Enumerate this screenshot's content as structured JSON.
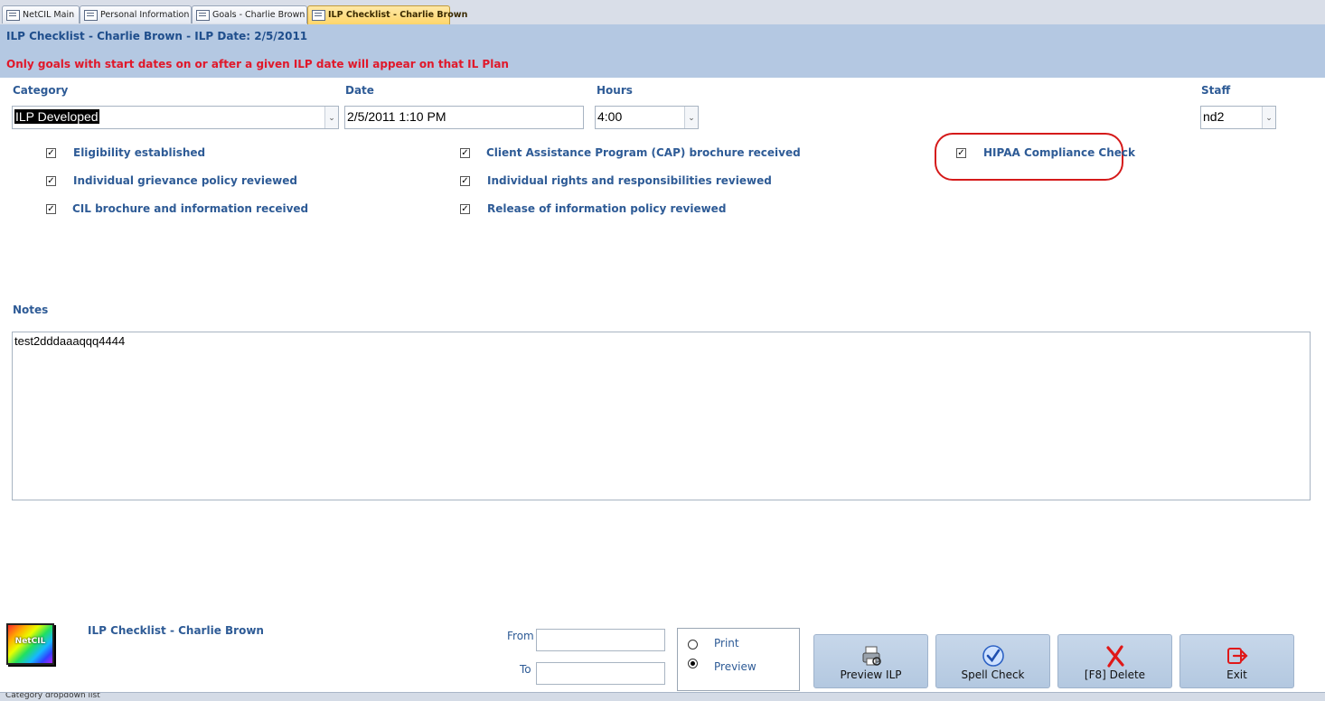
{
  "tabs": [
    {
      "label": "NetCIL Main",
      "active": false
    },
    {
      "label": "Personal Information",
      "active": false
    },
    {
      "label": "Goals - Charlie Brown",
      "active": false
    },
    {
      "label": "ILP Checklist - Charlie Brown",
      "active": true
    }
  ],
  "header": {
    "title": "ILP Checklist - Charlie Brown - ILP Date: 2/5/2011",
    "notice": "Only goals with start dates on or after a given ILP date will appear on that IL Plan",
    "notice_color": "#e0182a"
  },
  "form": {
    "category": {
      "label": "Category",
      "value": "ILP Developed"
    },
    "date": {
      "label": "Date",
      "value": "2/5/2011 1:10 PM"
    },
    "hours": {
      "label": "Hours",
      "value": "4:00"
    },
    "staff": {
      "label": "Staff",
      "value": "nd2"
    }
  },
  "checklist": [
    {
      "label": "Eligibility established",
      "checked": true
    },
    {
      "label": "Individual grievance policy reviewed",
      "checked": true
    },
    {
      "label": "CIL brochure and information received",
      "checked": true
    },
    {
      "label": "Client Assistance Program (CAP) brochure received",
      "checked": true
    },
    {
      "label": "Individual rights and responsibilities reviewed",
      "checked": true
    },
    {
      "label": "Release of information policy reviewed",
      "checked": true
    },
    {
      "label": "HIPAA Compliance Check",
      "checked": true
    }
  ],
  "notes": {
    "label": "Notes",
    "value": "test2dddaaaqqq4444"
  },
  "footer": {
    "logo_text": "NetCIL",
    "title": "ILP Checklist - Charlie Brown",
    "from_label": "From",
    "to_label": "To",
    "output_options": [
      {
        "label": "Print",
        "selected": false
      },
      {
        "label": "Preview",
        "selected": true
      }
    ],
    "buttons": [
      {
        "label": "Preview ILP",
        "icon": "preview-icon"
      },
      {
        "label": "Spell Check",
        "icon": "spell-check-icon"
      },
      {
        "label": "[F8] Delete",
        "icon": "delete-x-icon"
      },
      {
        "label": "Exit",
        "icon": "exit-icon"
      }
    ]
  },
  "status_bar": {
    "text": "Category dropdown list"
  },
  "colors": {
    "label_blue": "#2e5b96",
    "header_band": "#b4c8e2",
    "highlight_red": "#d51a1a",
    "active_tab": "#ffd66b"
  }
}
